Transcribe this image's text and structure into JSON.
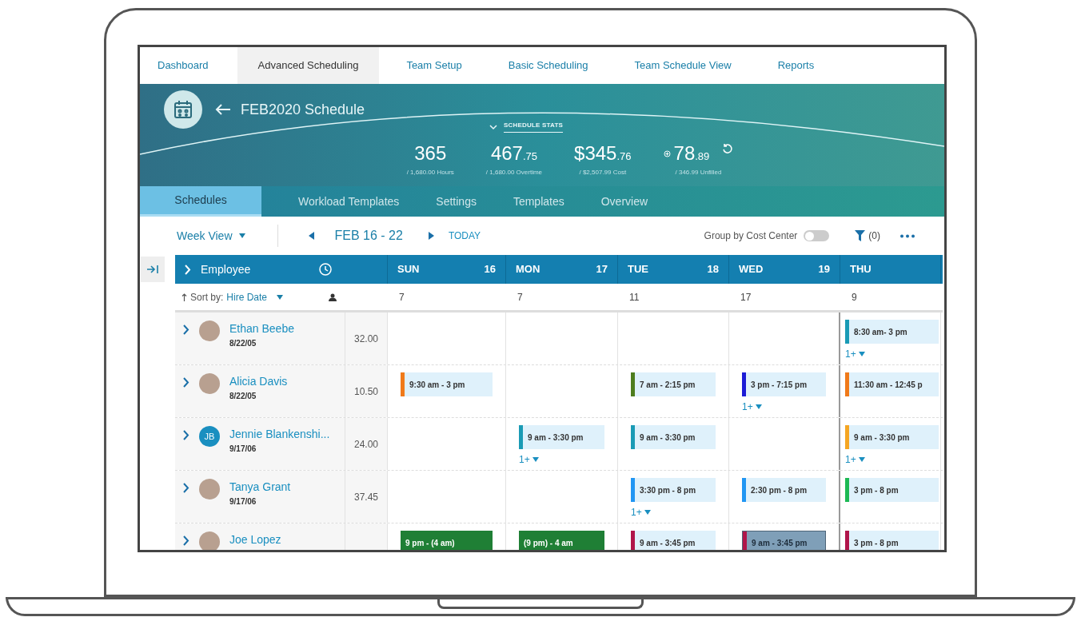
{
  "nav": [
    {
      "label": "Dashboard",
      "selected": false
    },
    {
      "label": "Advanced Scheduling",
      "selected": true
    },
    {
      "label": "Team Setup",
      "selected": false
    },
    {
      "label": "Basic Scheduling",
      "selected": false
    },
    {
      "label": "Team Schedule View",
      "selected": false
    },
    {
      "label": "Reports",
      "selected": false
    }
  ],
  "header": {
    "title": "FEB2020 Schedule",
    "stats_label": "SCHEDULE STATS",
    "stats": [
      {
        "value": "365",
        "sub": "/ 1,680.00 Hours"
      },
      {
        "value": "467",
        "decimals": ".75",
        "sub": "/ 1,680.00 Overtime"
      },
      {
        "value": "$345",
        "decimals": ".76",
        "sub": "/ $2,507.99 Cost"
      },
      {
        "value": "78",
        "decimals": ".89",
        "sub": "/ 346.99 Unfilled",
        "kind": "unfilled"
      }
    ]
  },
  "subtabs": [
    {
      "label": "Schedules",
      "selected": true
    },
    {
      "label": "Workload Templates",
      "selected": false
    },
    {
      "label": "Settings",
      "selected": false
    },
    {
      "label": "Templates",
      "selected": false
    },
    {
      "label": "Overview",
      "selected": false
    }
  ],
  "toolbar": {
    "view": "Week View",
    "range": "FEB 16 - 22",
    "today": "TODAY",
    "group_label": "Group by Cost Center",
    "group_on": false,
    "filter": "(0)"
  },
  "table": {
    "employee_label": "Employee",
    "sort_label": "Sort by:",
    "sort_value": "Hire Date",
    "days": [
      {
        "name": "SUN",
        "date": "16",
        "count": "7"
      },
      {
        "name": "MON",
        "date": "17",
        "count": "7"
      },
      {
        "name": "TUE",
        "date": "18",
        "count": "11"
      },
      {
        "name": "WED",
        "date": "19",
        "count": "17"
      },
      {
        "name": "THU",
        "count": "9"
      }
    ],
    "rows": [
      {
        "name": "Ethan Beebe",
        "date": "8/22/05",
        "hours": "32.00",
        "kind": "photo",
        "cells": [
          null,
          null,
          null,
          null,
          {
            "time": "8:30 am- 3 pm",
            "color": "#1a9bb5",
            "kind": "shift",
            "more": "1+"
          }
        ]
      },
      {
        "name": "Alicia Davis",
        "date": "8/22/05",
        "hours": "10.50",
        "kind": "photo",
        "cells": [
          {
            "time": "9:30 am - 3 pm",
            "color": "#f07a1a",
            "kind": "shift"
          },
          null,
          {
            "time": "7 am - 2:15 pm",
            "color": "#4e7d1e",
            "kind": "shift"
          },
          {
            "time": "3 pm - 7:15 pm",
            "color": "#1c1cd6",
            "kind": "shift",
            "more": "1+"
          },
          {
            "time": "11:30 am - 12:45 p",
            "color": "#f07a1a",
            "kind": "shift"
          }
        ]
      },
      {
        "name": "Jennie Blankenshi...",
        "date": "9/17/06",
        "hours": "24.00",
        "kind": "initials",
        "initials": "JB",
        "cells": [
          null,
          {
            "time": "9 am - 3:30 pm",
            "color": "#1a9bb5",
            "kind": "shift",
            "more": "1+"
          },
          {
            "time": "9 am - 3:30 pm",
            "color": "#1a9bb5",
            "kind": "shift"
          },
          null,
          {
            "time": "9 am - 3:30 pm",
            "color": "#f5a623",
            "kind": "shift",
            "more": "1+"
          }
        ]
      },
      {
        "name": "Tanya Grant",
        "date": "9/17/06",
        "hours": "37.45",
        "kind": "photo",
        "cells": [
          null,
          null,
          {
            "time": "3:30 pm - 8 pm",
            "color": "#2196f3",
            "kind": "shift",
            "more": "1+"
          },
          {
            "time": "2:30 pm - 8 pm",
            "color": "#2196f3",
            "kind": "shift"
          },
          {
            "time": "3 pm - 8 pm",
            "color": "#1db954",
            "kind": "shift"
          }
        ]
      },
      {
        "name": "Joe Lopez",
        "kind": "photo",
        "cells": [
          {
            "time": "9 pm - (4 am)",
            "color": "#1f7f35",
            "kind": "overnight"
          },
          {
            "time": "(9 pm) - 4 am",
            "color": "#1f7f35",
            "kind": "overnight"
          },
          {
            "time": "9 am - 3:45 pm",
            "color": "#b0154a",
            "kind": "shift"
          },
          {
            "time": "9 am - 3:45 pm",
            "color": "#b0154a",
            "kind": "selected"
          },
          {
            "time": "3 pm - 8 pm",
            "color": "#b0154a",
            "kind": "shift"
          }
        ]
      }
    ]
  }
}
